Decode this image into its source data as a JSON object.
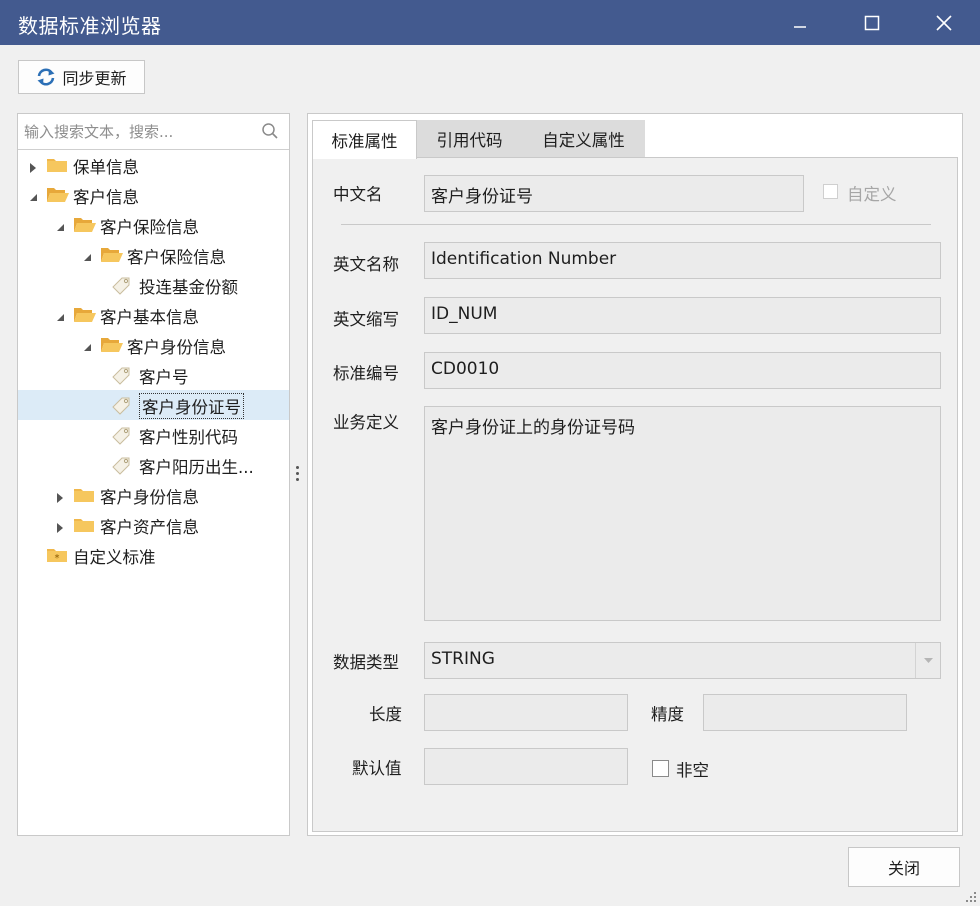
{
  "window": {
    "title": "数据标准浏览器",
    "controls": [
      "minimize",
      "maximize",
      "close"
    ]
  },
  "toolbar": {
    "sync_label": "同步更新"
  },
  "search": {
    "placeholder": "输入搜索文本，搜索..."
  },
  "tree": [
    {
      "label": "保单信息",
      "level": 0,
      "expanded": false,
      "icon": "folder-closed-icon"
    },
    {
      "label": "客户信息",
      "level": 0,
      "expanded": true,
      "icon": "folder-open-icon"
    },
    {
      "label": "客户保险信息",
      "level": 1,
      "expanded": true,
      "icon": "folder-open-icon"
    },
    {
      "label": "客户保险信息",
      "level": 2,
      "expanded": true,
      "icon": "folder-open-icon"
    },
    {
      "label": "投连基金份额",
      "level": 3,
      "icon": "tag-icon"
    },
    {
      "label": "客户基本信息",
      "level": 1,
      "expanded": true,
      "icon": "folder-open-icon"
    },
    {
      "label": "客户身份信息",
      "level": 2,
      "expanded": true,
      "icon": "folder-open-icon"
    },
    {
      "label": "客户号",
      "level": 3,
      "icon": "tag-icon"
    },
    {
      "label": "客户身份证号",
      "level": 3,
      "icon": "tag-icon",
      "selected": true
    },
    {
      "label": "客户性别代码",
      "level": 3,
      "icon": "tag-icon"
    },
    {
      "label": "客户阳历出生...",
      "level": 3,
      "icon": "tag-icon"
    },
    {
      "label": "客户身份信息",
      "level": 1,
      "expanded": false,
      "icon": "folder-closed-icon"
    },
    {
      "label": "客户资产信息",
      "level": 1,
      "expanded": false,
      "icon": "folder-closed-icon"
    },
    {
      "label": "自定义标准",
      "level": 0,
      "icon": "custom-folder-icon"
    }
  ],
  "tabs": [
    "标准属性",
    "引用代码",
    "自定义属性"
  ],
  "form": {
    "cn_name_label": "中文名",
    "cn_name_value": "客户身份证号",
    "custom_label": "自定义",
    "en_name_label": "英文名称",
    "en_name_value": "Identification Number",
    "en_abbr_label": "英文缩写",
    "en_abbr_value": "ID_NUM",
    "std_no_label": "标准编号",
    "std_no_value": "CD0010",
    "biz_def_label": "业务定义",
    "biz_def_value": "客户身份证上的身份证号码",
    "data_type_label": "数据类型",
    "data_type_value": "STRING",
    "length_label": "长度",
    "length_value": "",
    "precision_label": "精度",
    "precision_value": "",
    "default_label": "默认值",
    "default_value": "",
    "not_null_label": "非空"
  },
  "footer": {
    "close_label": "关闭"
  },
  "colors": {
    "titlebar": "#435a8f",
    "selection": "#dcebf7",
    "folder": "#f0b74a",
    "sync_icon": "#2b6fb6"
  }
}
